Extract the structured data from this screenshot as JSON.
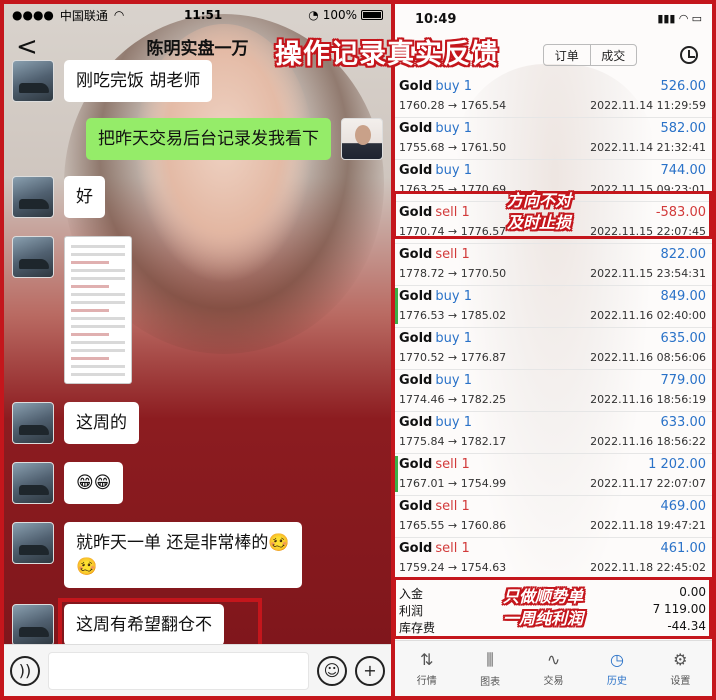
{
  "overlay_title": "操作记录真实反馈",
  "chat": {
    "status": {
      "carrier": "中国联通",
      "time": "11:51",
      "battery": "100%"
    },
    "title": "陈明实盘一万",
    "messages": [
      {
        "side": "other",
        "text": "刚吃完饭 胡老师"
      },
      {
        "side": "me",
        "text": "把昨天交易后台记录发我看下"
      },
      {
        "side": "other",
        "text": "好"
      },
      {
        "side": "other",
        "type": "image"
      },
      {
        "side": "other",
        "text": "这周的"
      },
      {
        "side": "other",
        "text": "😁😁"
      },
      {
        "side": "other",
        "text": "就昨天一单  还是非常棒的🥴",
        "text2": "🥴"
      },
      {
        "side": "other",
        "text": "这周有希望翻仓不"
      }
    ]
  },
  "trade": {
    "status": {
      "time": "10:49"
    },
    "tabs": [
      "订单",
      "成交"
    ],
    "deals": [
      {
        "symbol": "Gold",
        "side": "buy 1",
        "dir": "buy",
        "prices": "1760.28 → 1765.54",
        "profit": "526.00",
        "time": "2022.11.14 11:29:59",
        "mark": false
      },
      {
        "symbol": "Gold",
        "side": "buy 1",
        "dir": "buy",
        "prices": "1755.68 → 1761.50",
        "profit": "582.00",
        "time": "2022.11.14 21:32:41",
        "mark": false
      },
      {
        "symbol": "Gold",
        "side": "buy 1",
        "dir": "buy",
        "prices": "1763.25 → 1770.69",
        "profit": "744.00",
        "time": "2022.11.15 09:23:01",
        "mark": false
      },
      {
        "symbol": "Gold",
        "side": "sell 1",
        "dir": "sell",
        "prices": "1770.74 → 1776.57",
        "profit": "-583.00",
        "time": "2022.11.15 22:07:45",
        "mark": false
      },
      {
        "symbol": "Gold",
        "side": "sell 1",
        "dir": "sell",
        "prices": "1778.72 → 1770.50",
        "profit": "822.00",
        "time": "2022.11.15 23:54:31",
        "mark": false
      },
      {
        "symbol": "Gold",
        "side": "buy 1",
        "dir": "buy",
        "prices": "1776.53 → 1785.02",
        "profit": "849.00",
        "time": "2022.11.16 02:40:00",
        "mark": true
      },
      {
        "symbol": "Gold",
        "side": "buy 1",
        "dir": "buy",
        "prices": "1770.52 → 1776.87",
        "profit": "635.00",
        "time": "2022.11.16 08:56:06",
        "mark": false
      },
      {
        "symbol": "Gold",
        "side": "buy 1",
        "dir": "buy",
        "prices": "1774.46 → 1782.25",
        "profit": "779.00",
        "time": "2022.11.16 18:56:19",
        "mark": false
      },
      {
        "symbol": "Gold",
        "side": "buy 1",
        "dir": "buy",
        "prices": "1775.84 → 1782.17",
        "profit": "633.00",
        "time": "2022.11.16 18:56:22",
        "mark": false
      },
      {
        "symbol": "Gold",
        "side": "sell 1",
        "dir": "sell",
        "prices": "1767.01 → 1754.99",
        "profit": "1 202.00",
        "time": "2022.11.17 22:07:07",
        "mark": true
      },
      {
        "symbol": "Gold",
        "side": "sell 1",
        "dir": "sell",
        "prices": "1765.55 → 1760.86",
        "profit": "469.00",
        "time": "2022.11.18 19:47:21",
        "mark": false
      },
      {
        "symbol": "Gold",
        "side": "sell 1",
        "dir": "sell",
        "prices": "1759.24 → 1754.63",
        "profit": "461.00",
        "time": "2022.11.18 22:45:02",
        "mark": false
      }
    ],
    "summary": [
      {
        "label": "入金",
        "value": "0.00"
      },
      {
        "label": "利润",
        "value": "7 119.00"
      },
      {
        "label": "库存费",
        "value": "-44.34"
      }
    ],
    "notes": {
      "sell_line1": "方向不对",
      "sell_line2": "及时止损",
      "sum_line1": "只做顺势单",
      "sum_line2": "一周纯利润"
    },
    "tabbar": [
      {
        "label": "行情",
        "icon": "⇅"
      },
      {
        "label": "图表",
        "icon": "⫼"
      },
      {
        "label": "交易",
        "icon": "∿"
      },
      {
        "label": "历史",
        "icon": "◷"
      },
      {
        "label": "设置",
        "icon": "⚙"
      }
    ],
    "colors": {
      "buy": "#2a72c8",
      "sell": "#d23a3a",
      "accent": "#c4161c"
    }
  }
}
